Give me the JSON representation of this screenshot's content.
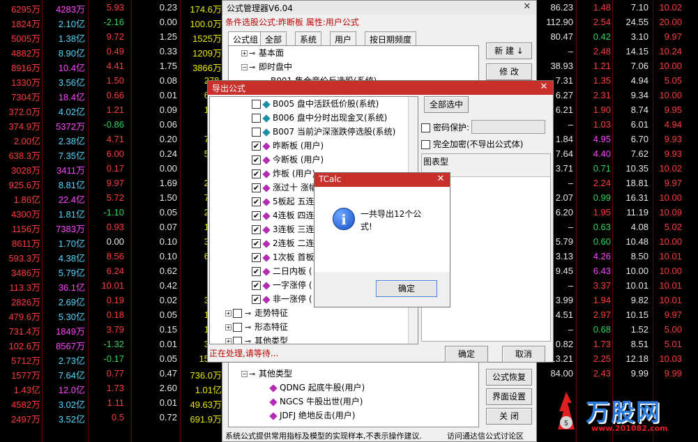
{
  "quote_table": {
    "rows": [
      [
        "6295万",
        "4283万",
        "5.93",
        "0.23",
        "174.6万",
        "86.23",
        "1.48",
        "7.10",
        "10.02"
      ],
      [
        "1824万",
        "2.10亿",
        "-2.16",
        "0.00",
        "100.0万",
        "112.90",
        "2.54",
        "24.55",
        "20.00"
      ],
      [
        "5005万",
        "1.38亿",
        "9.72",
        "1.25",
        "1525万",
        "80.47",
        "0.42",
        "3.10",
        "9.97"
      ],
      [
        "4882万",
        "8.90亿",
        "0.49",
        "0.33",
        "1209万",
        "–",
        "2.48",
        "14.15",
        "10.24"
      ],
      [
        "8916万",
        "10.4亿",
        "4.41",
        "1.75",
        "3866万",
        "38.93",
        "1.21",
        "7.06",
        "10.00"
      ],
      [
        "1330万",
        "3.56亿",
        "1.50",
        "0.08",
        "278.",
        "7.31",
        "1.35",
        "4.94",
        "5.05"
      ],
      [
        "7304万",
        "18.4亿",
        "0.66",
        "0.01",
        "670.",
        "6.27",
        "2.31",
        "9.34",
        "10.00"
      ],
      [
        "372.0万",
        "4.02亿",
        "1.21",
        "0.09",
        "140.",
        "6.21",
        "1.90",
        "8.74",
        "9.95"
      ],
      [
        "374.9万",
        "5372万",
        "-0.86",
        "0.06",
        "51.",
        "–",
        "1.03",
        "6.01",
        "4.94"
      ],
      [
        "2.00亿",
        "2.38亿",
        "4.71",
        "0.20",
        "722.",
        "1.84",
        "4.95",
        "6.70",
        "9.93"
      ],
      [
        "638.3万",
        "7.35亿",
        "6.00",
        "0.24",
        "594.",
        "7.64",
        "4.40",
        "7.62",
        "9.93"
      ],
      [
        "3028万",
        "3411万",
        "0.17",
        "0.00",
        "57.",
        "3.71",
        "0.71",
        "10.35",
        "10.02"
      ],
      [
        "925.6万",
        "8.81亿",
        "9.97",
        "1.69",
        "285.",
        "–",
        "2.24",
        "18.81",
        "9.97"
      ],
      [
        "1.86亿",
        "22.4亿",
        "5.72",
        "1.50",
        "764.",
        "2.07",
        "0.99",
        "16.31",
        "10.00"
      ],
      [
        "4300万",
        "1.81亿",
        "-1.10",
        "0.05",
        "260.",
        "6.20",
        "1.95",
        "11.19",
        "10.09"
      ],
      [
        "1156万",
        "7383万",
        "0.93",
        "0.07",
        "108.",
        "–",
        "0.63",
        "4.08",
        "5.02"
      ],
      [
        "8611万",
        "1.70亿",
        "0.00",
        "0.10",
        "366.",
        "5.79",
        "0.60",
        "10.48",
        "10.00"
      ],
      [
        "593.3万",
        "4.38亿",
        "8.56",
        "0.10",
        "615.",
        "3.13",
        "4.26",
        "8.50",
        "10.01"
      ],
      [
        "3486万",
        "5.79亿",
        "6.24",
        "0.62",
        "212",
        "9.45",
        "6.43",
        "10.00",
        "10.00"
      ],
      [
        "113.3万",
        "36.1亿",
        "10.01",
        "0.42",
        "1.1",
        "–",
        "3.37",
        "10.01",
        "10.01"
      ],
      [
        "2826万",
        "2.69亿",
        "0.19",
        "0.02",
        "30.3",
        "3.99",
        "1.94",
        "9.82",
        "10.01"
      ],
      [
        "479.6万",
        "5.30亿",
        "0.18",
        "0.05",
        "150.",
        "4.51",
        "2.97",
        "10.15",
        "9.97"
      ],
      [
        "731.4万",
        "1849万",
        "3.79",
        "0.15",
        "127.",
        "–",
        "0.68",
        "1.52",
        "5.00"
      ],
      [
        "102.6万",
        "8567万",
        "-1.32",
        "0.01",
        "39.7",
        "0.82",
        "1.73",
        "8.51",
        "5.01"
      ],
      [
        "5712万",
        "2.73亿",
        "-0.17",
        "0.05",
        "153.0",
        "13.21",
        "2.25",
        "12.18",
        "10.03"
      ],
      [
        "1577万",
        "7.64亿",
        "0.77",
        "0.47",
        "736.0万",
        "84.00",
        "2.43",
        "9.99",
        "9.99"
      ],
      [
        "1.43亿",
        "12.0亿",
        "1.73",
        "2.60",
        "1.01亿",
        "",
        "",
        "",
        ""
      ],
      [
        "4582万",
        "3.02亿",
        "1.11",
        "0.01",
        "49.63万",
        "",
        "",
        "",
        ""
      ],
      [
        "2497万",
        "3.52亿",
        "0.5",
        "0.72",
        "691.9万",
        "",
        "",
        "",
        ""
      ]
    ]
  },
  "formula_manager": {
    "title": "公式管理器V6.04",
    "subtitle": "条件选股公式:昨断板  属性:用户公式",
    "tabs": [
      "公式组",
      "全部",
      "系统",
      "用户",
      "按日期频度"
    ],
    "tree": [
      {
        "label": "基本面",
        "exp": "+",
        "level": 1
      },
      {
        "label": "即时盘中",
        "exp": "-",
        "level": 1
      },
      {
        "label": "B001 集合竞价反选股(系统)",
        "level": 2
      },
      {
        "label": "其他类型",
        "exp": "-",
        "level": 1
      },
      {
        "label": "QDNG  起底牛股(用户)",
        "level": 2
      },
      {
        "label": "NGCS  牛股出世(用户)",
        "level": 2
      },
      {
        "label": "JDFJ  绝地反击(用户)",
        "level": 2
      }
    ],
    "buttons": {
      "new": "新 建",
      "modify": "修 改",
      "restore": "公式恢复",
      "ui_settings": "界面设置",
      "close": "关 闭"
    },
    "footer": "系统公式提供常用指标及模型的实现样本,不表示操作建议.",
    "footer_link": "访问通达信公式讨论区"
  },
  "export_dialog": {
    "title": "导出公式",
    "items": [
      {
        "label": "B005 盘中活跃低价股(系统)",
        "checked": false,
        "sys": true
      },
      {
        "label": "B006 盘中分时出现金叉(系统)",
        "checked": false,
        "sys": true
      },
      {
        "label": "B007 当前沪深涨跌停选股(系统)",
        "checked": false,
        "sys": true
      },
      {
        "label": "昨断板 (用户)",
        "checked": true,
        "sys": false
      },
      {
        "label": "今断板 (用户)",
        "checked": true,
        "sys": false
      },
      {
        "label": "炸板 (用户)",
        "checked": true,
        "sys": false
      },
      {
        "label": "涨过十 涨幅",
        "checked": true,
        "sys": false
      },
      {
        "label": "5板起 五连",
        "checked": true,
        "sys": false
      },
      {
        "label": "4连板 四连",
        "checked": true,
        "sys": false
      },
      {
        "label": "3连板 三连",
        "checked": true,
        "sys": false
      },
      {
        "label": "2连板 二连",
        "checked": true,
        "sys": false
      },
      {
        "label": "1次板 首板",
        "checked": true,
        "sys": false
      },
      {
        "label": "二日内板 (",
        "checked": true,
        "sys": false
      },
      {
        "label": "一字涨停 (",
        "checked": true,
        "sys": false
      },
      {
        "label": "非一涨停 (",
        "checked": true,
        "sys": false
      }
    ],
    "groups": [
      "走势特征",
      "形态特征",
      "其他类型"
    ],
    "select_all": "全部选中",
    "password_label": "密码保护:",
    "encrypt_label": "完全加密(不导出公式体)",
    "chart_type_label": "图表型",
    "status": "正在处理,请等待...",
    "ok": "确定",
    "cancel": "取消"
  },
  "tcalc": {
    "title": "TCalc",
    "message_line1": "一共导出12个公",
    "message_line2": "式!",
    "ok": "确定"
  },
  "watermark": {
    "brand": "万股网",
    "url": "www.201082.com"
  },
  "colors": {
    "up": "#ff3b3b",
    "down": "#2fd35a",
    "white": "#e8e8e8",
    "yellow": "#e8e800",
    "magenta": "#ff44ff",
    "cyan": "#4fd8ff"
  }
}
